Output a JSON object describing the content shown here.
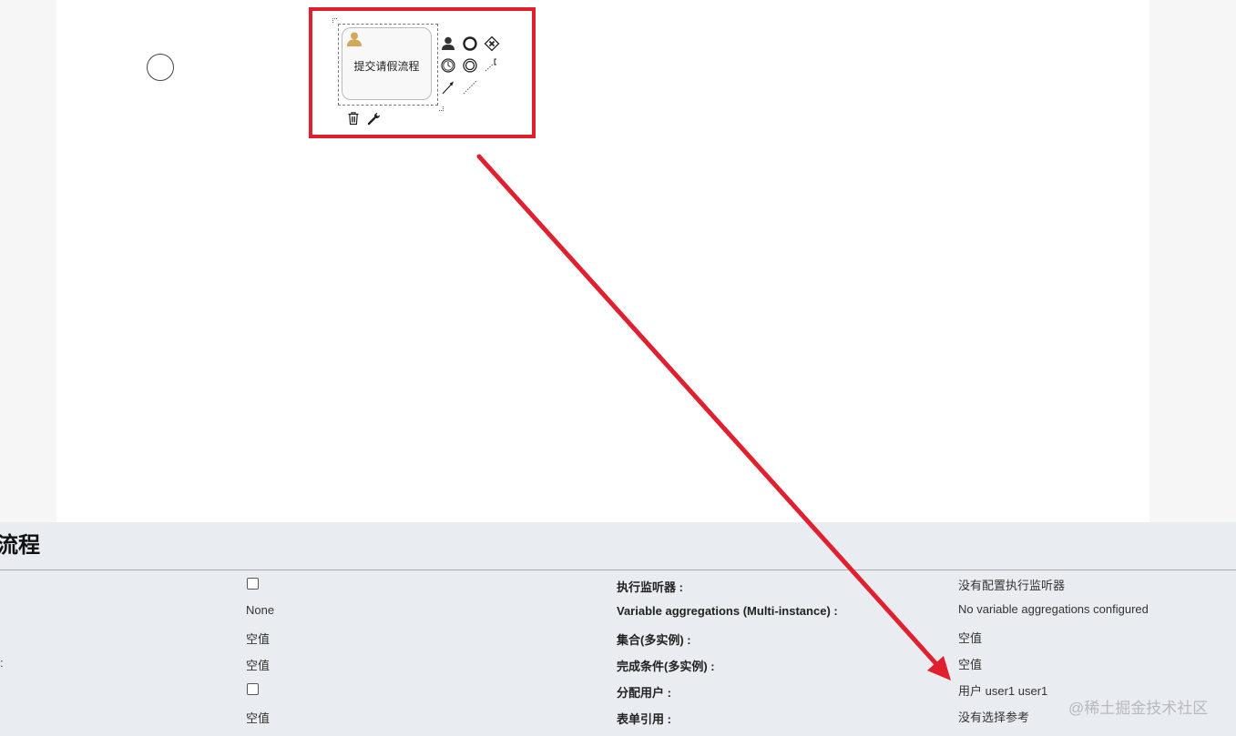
{
  "canvas": {
    "task_label": "提交请假流程"
  },
  "palette": {
    "icons": [
      "user-task-icon",
      "end-event-icon",
      "gateway-icon",
      "intermediate-timer-icon",
      "end-event-double-icon",
      "association-icon",
      "sequence-flow-icon",
      "dotted-flow-icon",
      "delete-icon",
      "wrench-icon"
    ]
  },
  "properties": {
    "title": "流程",
    "rows": [
      {
        "left_label": "",
        "value1": "",
        "value1_type": "checkbox",
        "label2": "执行监听器 :",
        "value2": "没有配置执行监听器"
      },
      {
        "left_label": "",
        "value1": "None",
        "value1_type": "text",
        "label2": "Variable aggregations (Multi-instance) :",
        "value2": "No variable aggregations configured"
      },
      {
        "left_label": "",
        "value1": "空值",
        "value1_type": "text",
        "label2": "集合(多实例) :",
        "value2": "空值"
      },
      {
        "left_label": ":",
        "value1": "空值",
        "value1_type": "text",
        "label2": "完成条件(多实例) :",
        "value2": "空值"
      },
      {
        "left_label": "",
        "value1": "",
        "value1_type": "checkbox",
        "label2": "分配用户 :",
        "value2": "用户 user1 user1"
      },
      {
        "left_label": "",
        "value1": "空值",
        "value1_type": "text",
        "label2": "表单引用 :",
        "value2": "没有选择参考"
      }
    ]
  },
  "watermark": "@稀土掘金技术社区",
  "colors": {
    "highlight": "#e0202e",
    "panel_bg": "#e9ecf1",
    "canvas_bg": "#ffffff",
    "user_icon": "#d4a85a"
  }
}
